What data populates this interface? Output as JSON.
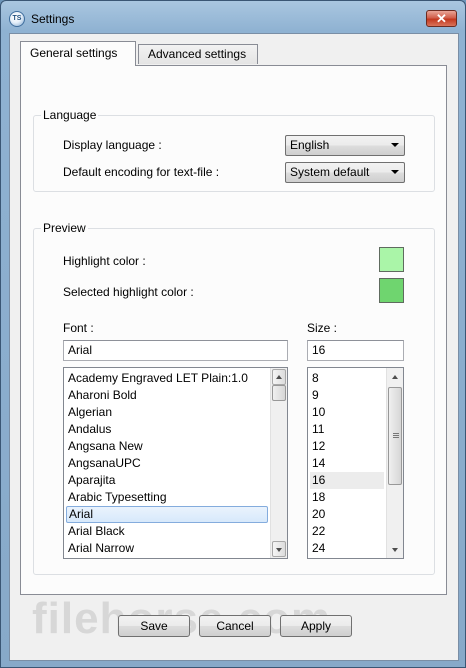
{
  "window": {
    "title": "Settings",
    "icon_text": "TS",
    "close_label": "✕"
  },
  "tabs": [
    {
      "label": "General settings",
      "active": true
    },
    {
      "label": "Advanced settings",
      "active": false
    }
  ],
  "language": {
    "group_label": "Language",
    "display_language_label": "Display language :",
    "display_language_value": "English",
    "encoding_label": "Default encoding for text-file :",
    "encoding_value": "System default"
  },
  "preview": {
    "group_label": "Preview",
    "highlight_color_label": "Highlight color :",
    "highlight_color": "#aaf5a8",
    "selected_highlight_color_label": "Selected highlight color :",
    "selected_highlight_color": "#6fd56f",
    "font_label": "Font :",
    "font_value": "Arial",
    "size_label": "Size :",
    "size_value": "16",
    "fonts": [
      "Academy Engraved LET Plain:1.0",
      "Aharoni Bold",
      "Algerian",
      "Andalus",
      "Angsana New",
      "AngsanaUPC",
      "Aparajita",
      "Arabic Typesetting",
      "Arial",
      "Arial Black",
      "Arial Narrow"
    ],
    "selected_font": "Arial",
    "sizes": [
      "8",
      "9",
      "10",
      "11",
      "12",
      "14",
      "16",
      "18",
      "20",
      "22",
      "24"
    ],
    "selected_size": "16"
  },
  "buttons": {
    "save": "Save",
    "cancel": "Cancel",
    "apply": "Apply"
  },
  "watermark": "filehorse.com"
}
